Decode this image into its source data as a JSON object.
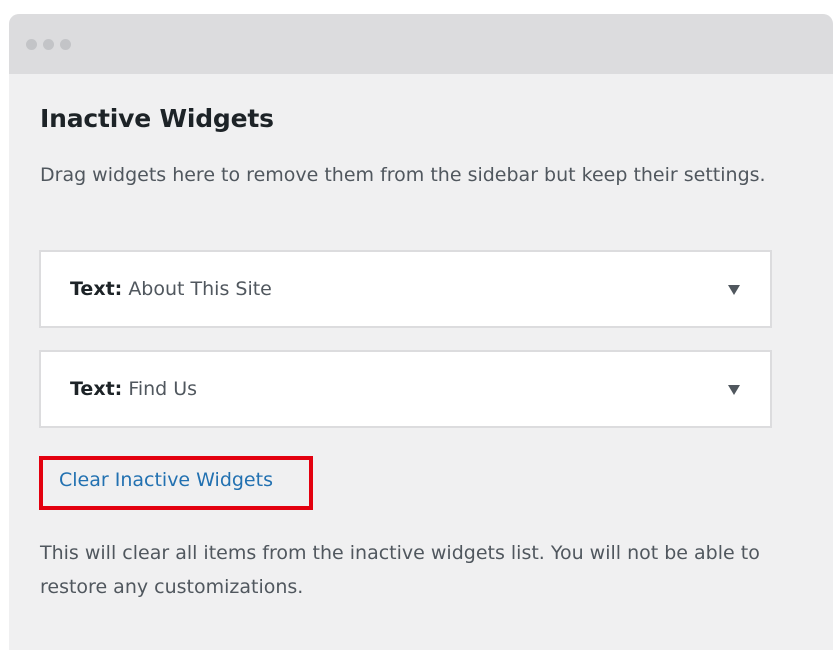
{
  "panel": {
    "title": "Inactive Widgets",
    "description": "Drag widgets here to remove them from the sidebar but keep their settings."
  },
  "widgets": [
    {
      "prefix": "Text:",
      "name": "About This Site",
      "toggle_icon": "triangle-down"
    },
    {
      "prefix": "Text:",
      "name": "Find Us",
      "toggle_icon": "triangle-down"
    }
  ],
  "clear_action": {
    "label": "Clear Inactive Widgets",
    "highlight_color": "#e3000f"
  },
  "warning_text": "This will clear all items from the inactive widgets list. You will not be able to restore any customizations.",
  "colors": {
    "link": "#2271b1",
    "panel_background": "#f0f0f1",
    "titlebar": "#dcdcde"
  }
}
